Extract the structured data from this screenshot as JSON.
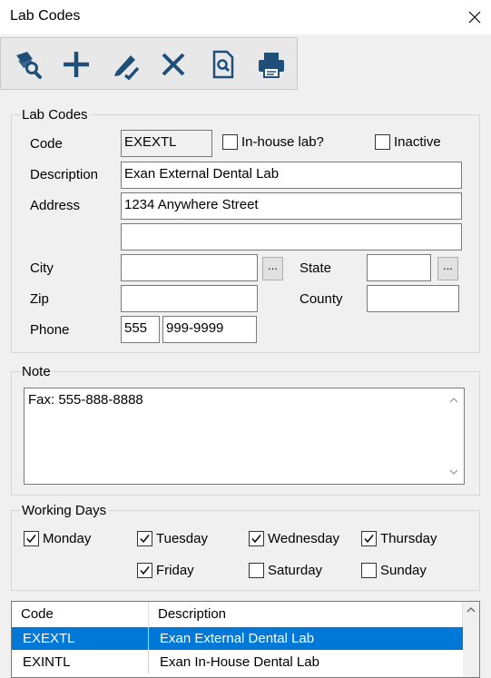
{
  "window": {
    "title": "Lab Codes"
  },
  "toolbar": [
    "search-records-icon",
    "add-icon",
    "edit-icon",
    "delete-icon",
    "preview-icon",
    "print-icon"
  ],
  "lab_codes": {
    "legend": "Lab Codes",
    "code_label": "Code",
    "code_value": "EXEXTL",
    "inhouse_label": "In-house lab?",
    "inhouse_checked": false,
    "inactive_label": "Inactive",
    "inactive_checked": false,
    "description_label": "Description",
    "description_value": "Exan External Dental Lab",
    "address_label": "Address",
    "address1_value": "1234 Anywhere Street",
    "address2_value": "",
    "city_label": "City",
    "city_value": "",
    "city_button": "...",
    "state_label": "State",
    "state_value": "",
    "state_button": "...",
    "zip_label": "Zip",
    "zip_value": "",
    "county_label": "County",
    "county_value": "",
    "phone_label": "Phone",
    "phone_area": "555",
    "phone_number": "999-9999"
  },
  "note": {
    "legend": "Note",
    "text": "Fax: 555-888-8888"
  },
  "working_days": {
    "legend": "Working Days",
    "days": [
      {
        "label": "Monday",
        "checked": true
      },
      {
        "label": "Tuesday",
        "checked": true
      },
      {
        "label": "Wednesday",
        "checked": true
      },
      {
        "label": "Thursday",
        "checked": true
      },
      {
        "label": "Friday",
        "checked": true
      },
      {
        "label": "Saturday",
        "checked": false
      },
      {
        "label": "Sunday",
        "checked": false
      }
    ]
  },
  "grid": {
    "headers": [
      "Code",
      "Description"
    ],
    "rows": [
      {
        "code": "EXEXTL",
        "description": "Exan External Dental Lab",
        "selected": true
      },
      {
        "code": "EXINTL",
        "description": "Exan In-House Dental Lab",
        "selected": false
      }
    ]
  },
  "colors": {
    "selection": "#0078d7",
    "toolbar_icon": "#1f4e79"
  }
}
